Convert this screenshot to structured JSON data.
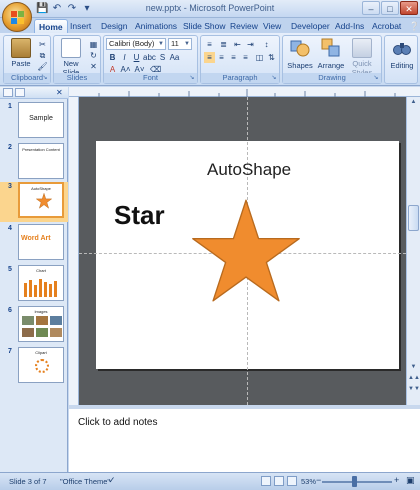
{
  "window": {
    "title": "new.pptx - Microsoft PowerPoint"
  },
  "ribbon_tabs": [
    "Home",
    "Insert",
    "Design",
    "Animations",
    "Slide Show",
    "Review",
    "View",
    "Developer",
    "Add-Ins",
    "Acrobat"
  ],
  "active_tab": "Home",
  "ribbon": {
    "clipboard": {
      "label": "Clipboard",
      "paste": "Paste"
    },
    "slides": {
      "label": "Slides",
      "new_slide": "New Slide"
    },
    "font": {
      "label": "Font",
      "family": "Calibri (Body)",
      "size": "11",
      "bold": "B",
      "italic": "I",
      "underline": "U",
      "shadow": "S",
      "strike": "abc",
      "grow": "A˄",
      "shrink": "A˅",
      "aa": "Aa",
      "color_a": "A"
    },
    "paragraph": {
      "label": "Paragraph"
    },
    "drawing": {
      "label": "Drawing",
      "shapes": "Shapes",
      "arrange": "Arrange",
      "quick_styles": "Quick Styles"
    },
    "editing": {
      "label": "Editing"
    }
  },
  "thumbnails": [
    {
      "num": "1",
      "text": "Sample"
    },
    {
      "num": "2",
      "text": "Presentation Content"
    },
    {
      "num": "3",
      "text": "AutoShape"
    },
    {
      "num": "4",
      "text": "Word Art"
    },
    {
      "num": "5",
      "text": "Chart"
    },
    {
      "num": "6",
      "text": "Images"
    },
    {
      "num": "7",
      "text": "Clipart"
    }
  ],
  "selected_slide": 3,
  "slide": {
    "title": "Star",
    "subtitle": "AutoShape",
    "star_fill": "#f08c2e",
    "star_stroke": "#b86a1e"
  },
  "notes": {
    "placeholder": "Click to add notes"
  },
  "status": {
    "slide": "Slide 3 of 7",
    "theme": "\"Office Theme\"",
    "zoom": "53%"
  }
}
